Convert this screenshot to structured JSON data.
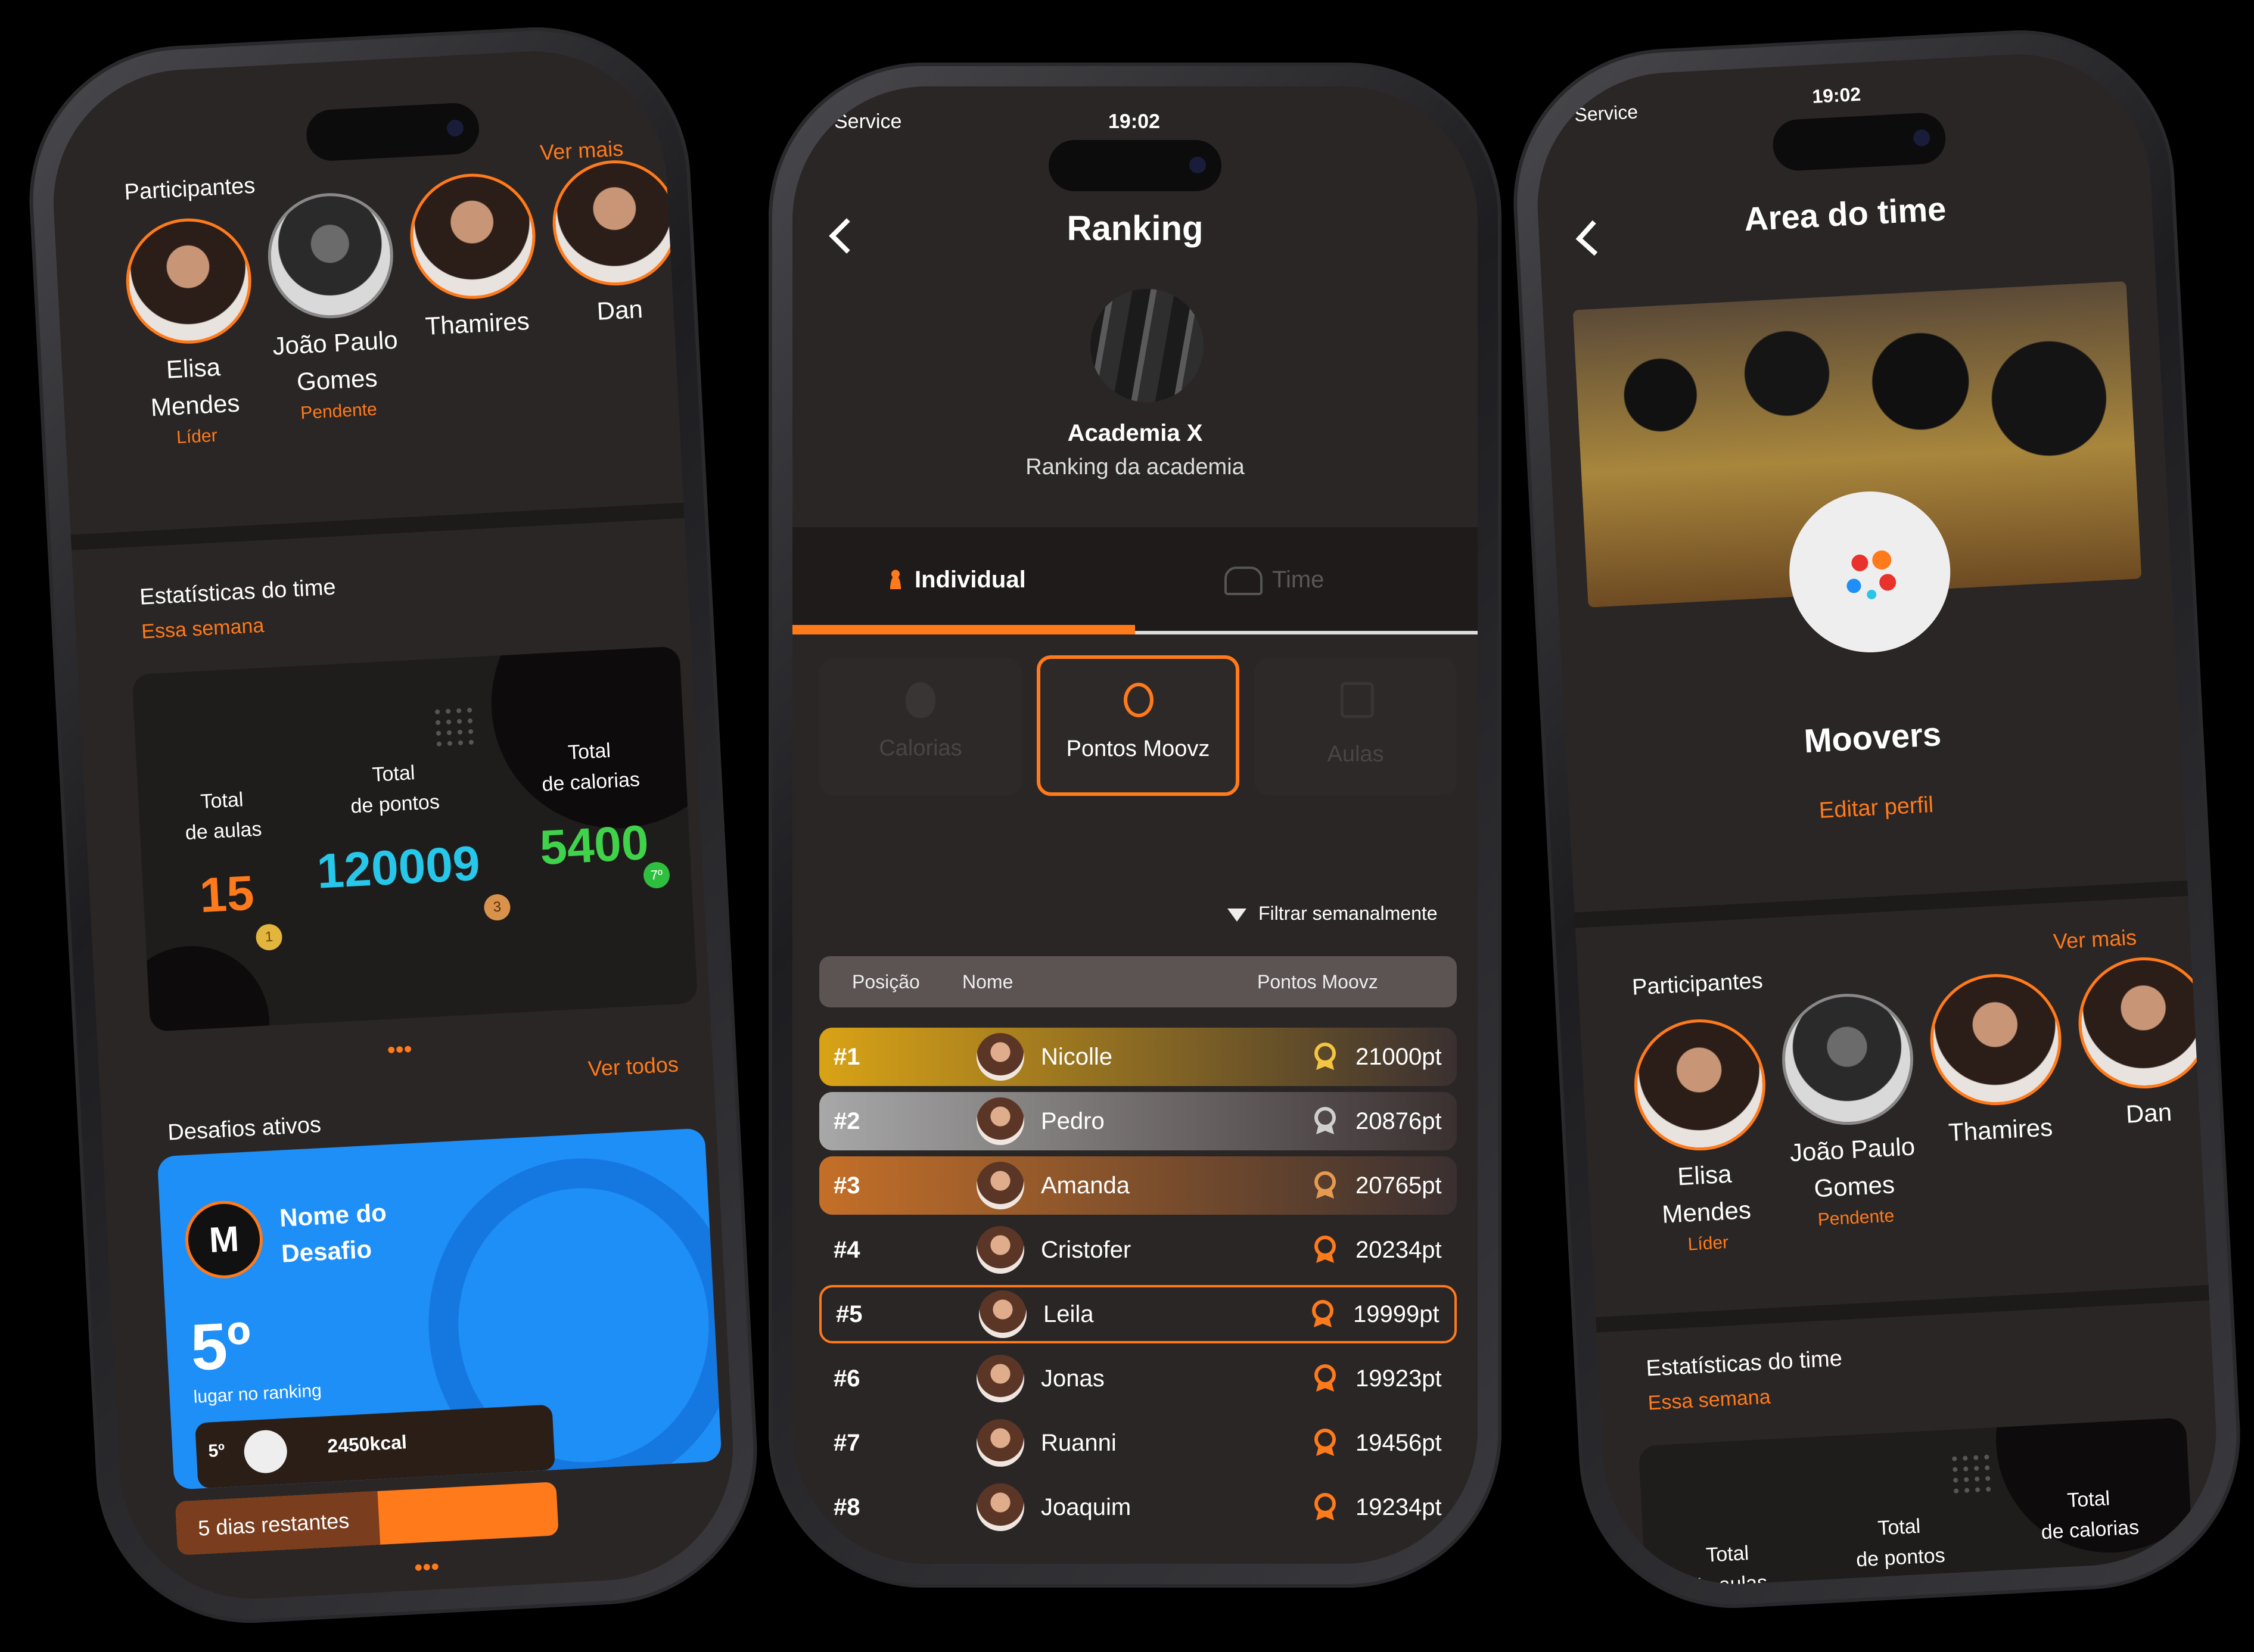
{
  "left": {
    "participants_title": "Participantes",
    "ver_mais": "Ver mais",
    "people": [
      {
        "name_line1": "Elisa",
        "name_line2": "Mendes",
        "tag": "Líder"
      },
      {
        "name_line1": "João Paulo",
        "name_line2": "Gomes",
        "tag": "Pendente"
      },
      {
        "name_line1": "Thamires",
        "name_line2": "",
        "tag": ""
      },
      {
        "name_line1": "Dan",
        "name_line2": "",
        "tag": ""
      }
    ],
    "stats_title": "Estatísticas do time",
    "stats_period": "Essa semana",
    "stats": [
      {
        "label1": "Total",
        "label2": "de aulas",
        "value": "15",
        "badge": "1"
      },
      {
        "label1": "Total",
        "label2": "de pontos",
        "value": "120009",
        "badge": "3"
      },
      {
        "label1": "Total",
        "label2": "de calorias",
        "value": "5400",
        "badge": "7º"
      }
    ],
    "challenges_title": "Desafios ativos",
    "ver_todos": "Ver todos",
    "challenge": {
      "logo_letter": "M",
      "name_line1": "Nome do",
      "name_line2": "Desafio",
      "rank": "5º",
      "rank_label": "lugar no ranking",
      "mini_rank": "5º",
      "kcal": "2450kcal",
      "days_left": "5 dias restantes"
    }
  },
  "middle": {
    "status_carrier": "Service",
    "time": "19:02",
    "title": "Ranking",
    "gym_name": "Academia X",
    "gym_subtitle": "Ranking da academia",
    "tabs": [
      "Individual",
      "Time"
    ],
    "categories": [
      "Calorias",
      "Pontos Moovz",
      "Aulas"
    ],
    "filter": "Filtrar semanalmente",
    "columns": [
      "Posição",
      "Nome",
      "Pontos Moovz"
    ],
    "rows": [
      {
        "pos": "#1",
        "name": "Nicolle",
        "points": "21000pt"
      },
      {
        "pos": "#2",
        "name": "Pedro",
        "points": "20876pt"
      },
      {
        "pos": "#3",
        "name": "Amanda",
        "points": "20765pt"
      },
      {
        "pos": "#4",
        "name": "Cristofer",
        "points": "20234pt"
      },
      {
        "pos": "#5",
        "name": "Leila",
        "points": "19999pt"
      },
      {
        "pos": "#6",
        "name": "Jonas",
        "points": "19923pt"
      },
      {
        "pos": "#7",
        "name": "Ruanni",
        "points": "19456pt"
      },
      {
        "pos": "#8",
        "name": "Joaquim",
        "points": "19234pt"
      }
    ]
  },
  "right": {
    "status_carrier": "Service",
    "time": "19:02",
    "title": "Area do time",
    "team_name": "Moovers",
    "edit_profile": "Editar perfil",
    "participants_title": "Participantes",
    "ver_mais": "Ver mais",
    "people": [
      {
        "name_line1": "Elisa",
        "name_line2": "Mendes",
        "tag": "Líder"
      },
      {
        "name_line1": "João Paulo",
        "name_line2": "Gomes",
        "tag": "Pendente"
      },
      {
        "name_line1": "Thamires",
        "name_line2": "",
        "tag": ""
      },
      {
        "name_line1": "Dan",
        "name_line2": "",
        "tag": ""
      }
    ],
    "stats_title": "Estatísticas do time",
    "stats_period": "Essa semana",
    "stats": [
      {
        "label1": "Total",
        "label2": "de aulas"
      },
      {
        "label1": "Total",
        "label2": "de pontos"
      },
      {
        "label1": "Total",
        "label2": "de calorias"
      }
    ]
  },
  "colors": {
    "accent": "#ff7a1a",
    "challenge_blue": "#1e8ff7",
    "gold": "#d9a316",
    "silver": "#9a9a9a",
    "bronze": "#c46f28"
  }
}
